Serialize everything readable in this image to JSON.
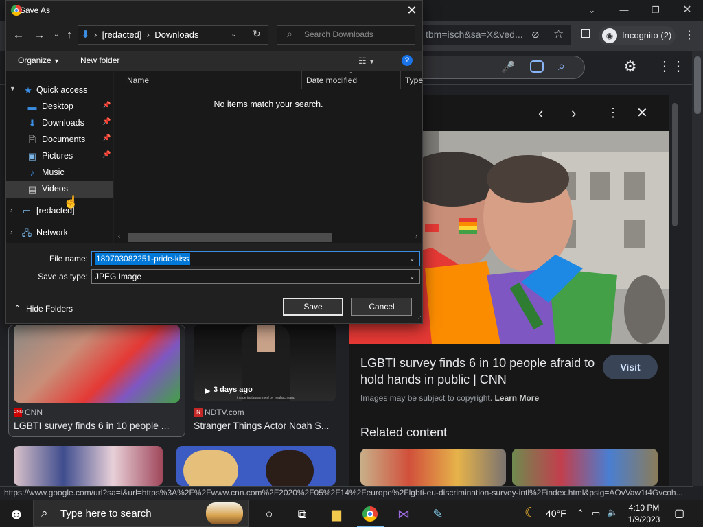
{
  "browser": {
    "omnibox_text": "tbm=isch&sa=X&ved...",
    "incognito_label": "Incognito (2)",
    "status_url": "https://www.google.com/url?sa=i&url=https%3A%2F%2Fwww.cnn.com%2F2020%2F05%2F14%2Feurope%2Flgbti-eu-discrimination-survey-intl%2Findex.html&psig=AOvVaw1t4Gvcoh..."
  },
  "viewer": {
    "title": "LGBTI survey finds 6 in 10 people afraid to hold hands in public | CNN",
    "visit_label": "Visit",
    "copyright_text": "Images may be subject to copyright.",
    "learn_more": "Learn More",
    "related_heading": "Related content"
  },
  "results": [
    {
      "source": "CNN",
      "title": "LGBTI survey finds 6 in 10 people ...",
      "badge": "CNN"
    },
    {
      "source": "NDTV.com",
      "title": "Stranger Things Actor Noah S...",
      "badge": "N",
      "overlay": "3 days ago",
      "caption": "image instagrammed by noahschnapp"
    }
  ],
  "dialog": {
    "title": "Save As",
    "breadcrumb": [
      "[redacted]",
      "Downloads"
    ],
    "search_placeholder": "Search Downloads",
    "organize_label": "Organize",
    "new_folder_label": "New folder",
    "nav_items": [
      {
        "label": "Quick access",
        "icon": "star-icon"
      },
      {
        "label": "Desktop",
        "icon": "desktop-icon",
        "pinned": true
      },
      {
        "label": "Downloads",
        "icon": "download-icon",
        "pinned": true
      },
      {
        "label": "Documents",
        "icon": "document-icon",
        "pinned": true
      },
      {
        "label": "Pictures",
        "icon": "pictures-icon",
        "pinned": true
      },
      {
        "label": "Music",
        "icon": "music-icon"
      },
      {
        "label": "Videos",
        "icon": "video-icon",
        "selected": true
      },
      {
        "label": "[redacted]",
        "icon": "computer-icon"
      },
      {
        "label": "Network",
        "icon": "network-icon"
      }
    ],
    "columns": [
      "Name",
      "Date modified",
      "Type"
    ],
    "empty_message": "No items match your search.",
    "file_name_label": "File name:",
    "file_name_value": "180703082251-pride-kiss",
    "save_type_label": "Save as type:",
    "save_type_value": "JPEG Image",
    "hide_folders_label": "Hide Folders",
    "save_label": "Save",
    "cancel_label": "Cancel"
  },
  "taskbar": {
    "search_placeholder": "Type here to search",
    "temperature": "40°F",
    "time": "4:10 PM",
    "date": "1/9/2023"
  },
  "colors": {
    "accent": "#0078d7",
    "dialog_bg": "#202020",
    "visit_button": "#394457"
  }
}
